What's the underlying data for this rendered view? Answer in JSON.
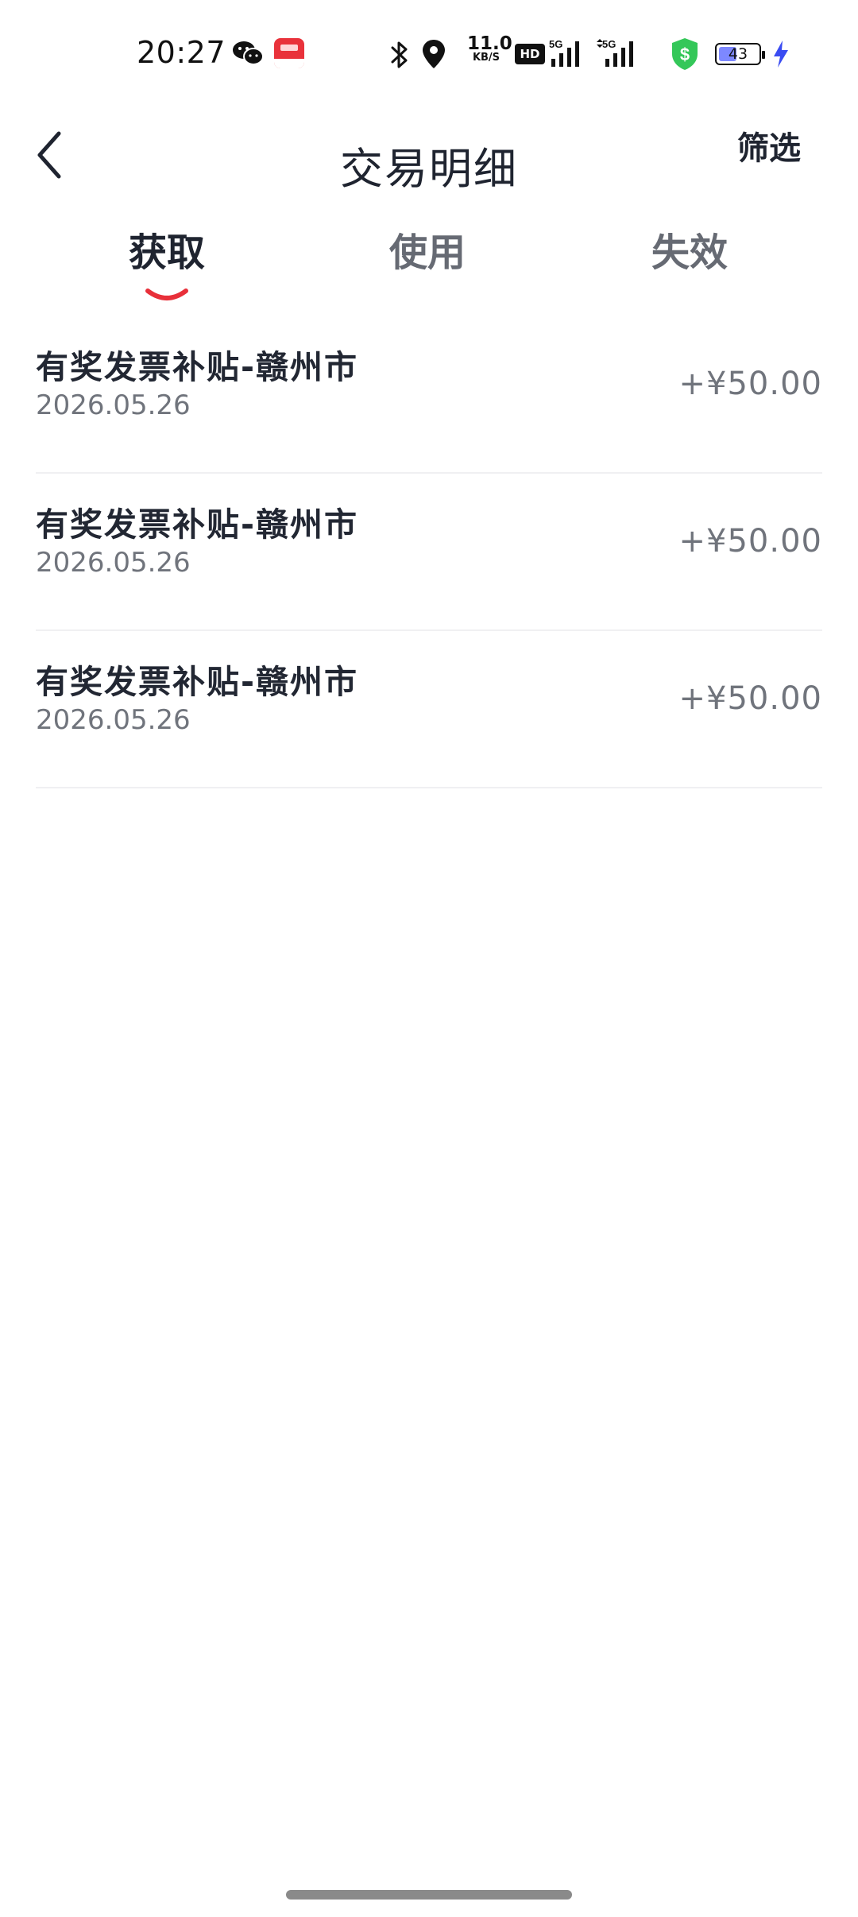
{
  "status_bar": {
    "time": "20:27",
    "network_speed_value": "11.0",
    "network_speed_unit": "KB/S",
    "hd_label": "HD",
    "signal1_label": "5G",
    "signal2_label": "5G",
    "battery_level": "43",
    "icons": [
      "wechat-icon",
      "app-notification-icon",
      "bluetooth-icon",
      "location-icon",
      "hd-icon",
      "signal-5g-icon",
      "signal-5g-icon",
      "security-shield-icon",
      "battery-icon",
      "charging-icon"
    ],
    "colors": {
      "shield": "#34c759",
      "battery_fill": "#7d88ff",
      "charging": "#3a4cf2"
    }
  },
  "header": {
    "title": "交易明细",
    "filter_label": "筛选",
    "back_icon": "chevron-left-icon"
  },
  "tabs": [
    {
      "label": "获取",
      "active": true
    },
    {
      "label": "使用",
      "active": false
    },
    {
      "label": "失效",
      "active": false
    }
  ],
  "accent_color": "#e8303a",
  "transactions": [
    {
      "title": "有奖发票补贴-赣州市",
      "date": "2026.05.26",
      "amount": "+¥50.00"
    },
    {
      "title": "有奖发票补贴-赣州市",
      "date": "2026.05.26",
      "amount": "+¥50.00"
    },
    {
      "title": "有奖发票补贴-赣州市",
      "date": "2026.05.26",
      "amount": "+¥50.00"
    }
  ]
}
